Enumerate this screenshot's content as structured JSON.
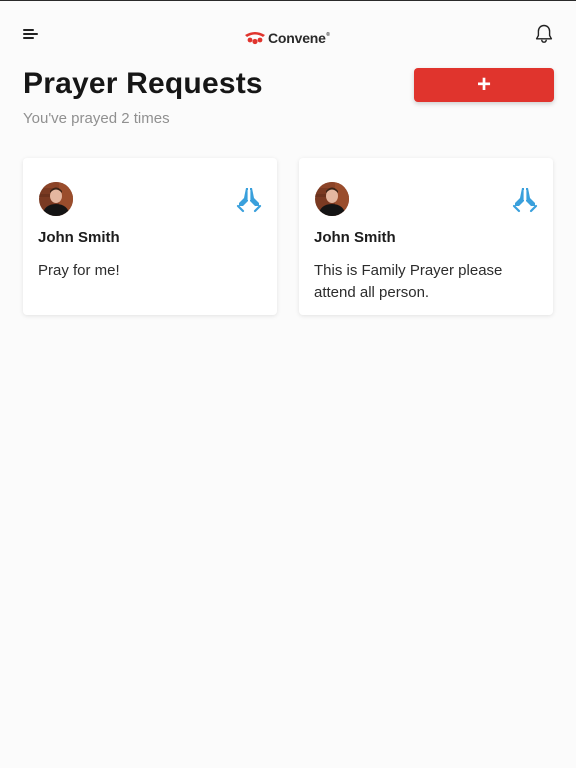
{
  "header": {
    "brand_name": "Convene",
    "brand_mark": "®",
    "title": "Prayer Requests",
    "prayed_count_text": "You've prayed 2 times",
    "add_button_label": "+"
  },
  "icons": {
    "menu": "menu-icon",
    "bell": "bell-icon",
    "pray": "praying-hands-icon"
  },
  "colors": {
    "accent": "#e0342d",
    "pray_icon": "#3aa0dc",
    "background": "#fbfbfb",
    "card": "#ffffff",
    "muted_text": "#909090"
  },
  "requests": [
    {
      "name": "John Smith",
      "message": "Pray for me!"
    },
    {
      "name": "John Smith",
      "message": "This is Family Prayer please attend all person."
    }
  ]
}
